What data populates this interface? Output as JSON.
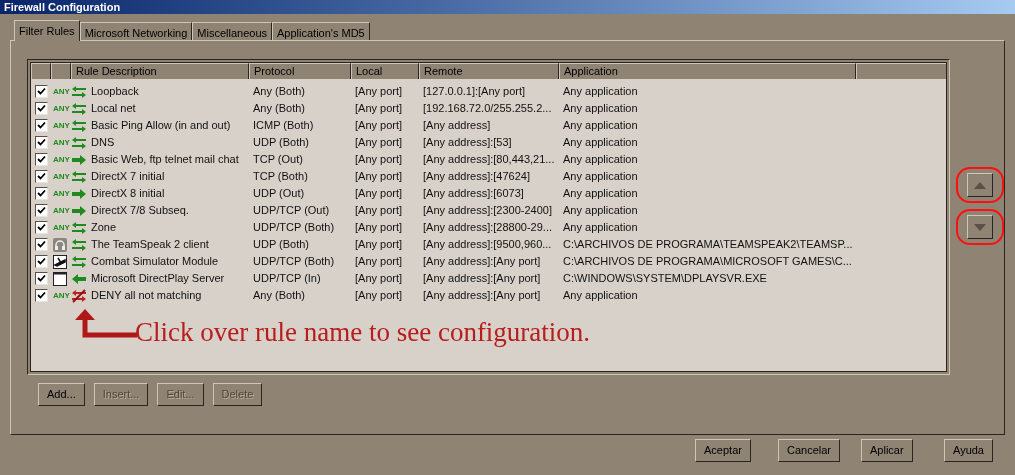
{
  "window": {
    "title": "Firewall Configuration"
  },
  "tabs": [
    {
      "label": "Filter Rules",
      "selected": true
    },
    {
      "label": "Microsoft Networking",
      "selected": false
    },
    {
      "label": "Miscellaneous",
      "selected": false
    },
    {
      "label": "Application's MD5",
      "selected": false
    }
  ],
  "table": {
    "columns": [
      "Rule Description",
      "Protocol",
      "Local",
      "Remote",
      "Application"
    ],
    "rows": [
      {
        "checked": true,
        "source": {
          "kind": "any",
          "label": "ANY"
        },
        "arrow": {
          "kind": "both"
        },
        "description": "Loopback",
        "protocol": "Any (Both)",
        "local": "[Any port]",
        "remote": "[127.0.0.1]:[Any port]",
        "application": "Any application"
      },
      {
        "checked": true,
        "source": {
          "kind": "any",
          "label": "ANY"
        },
        "arrow": {
          "kind": "both"
        },
        "description": "Local net",
        "protocol": "Any (Both)",
        "local": "[Any port]",
        "remote": "[192.168.72.0/255.255.2...",
        "application": "Any application"
      },
      {
        "checked": true,
        "source": {
          "kind": "any",
          "label": "ANY"
        },
        "arrow": {
          "kind": "both"
        },
        "description": "Basic Ping Allow (in and out)",
        "protocol": "ICMP (Both)",
        "local": "[Any port]",
        "remote": "[Any address]",
        "application": "Any application"
      },
      {
        "checked": true,
        "source": {
          "kind": "any",
          "label": "ANY"
        },
        "arrow": {
          "kind": "both"
        },
        "description": "DNS",
        "protocol": "UDP (Both)",
        "local": "[Any port]",
        "remote": "[Any address]:[53]",
        "application": "Any application"
      },
      {
        "checked": true,
        "source": {
          "kind": "any",
          "label": "ANY"
        },
        "arrow": {
          "kind": "out"
        },
        "description": "Basic Web, ftp telnet mail chat",
        "protocol": "TCP (Out)",
        "local": "[Any port]",
        "remote": "[Any address]:[80,443,21...",
        "application": "Any application"
      },
      {
        "checked": true,
        "source": {
          "kind": "any",
          "label": "ANY"
        },
        "arrow": {
          "kind": "both"
        },
        "description": "DirectX 7 initial",
        "protocol": "TCP (Both)",
        "local": "[Any port]",
        "remote": "[Any address]:[47624]",
        "application": "Any application"
      },
      {
        "checked": true,
        "source": {
          "kind": "any",
          "label": "ANY"
        },
        "arrow": {
          "kind": "out"
        },
        "description": "DirectX 8 initial",
        "protocol": "UDP (Out)",
        "local": "[Any port]",
        "remote": "[Any address]:[6073]",
        "application": "Any application"
      },
      {
        "checked": true,
        "source": {
          "kind": "any",
          "label": "ANY"
        },
        "arrow": {
          "kind": "out"
        },
        "description": "DirectX  7/8 Subseq.",
        "protocol": "UDP/TCP (Out)",
        "local": "[Any port]",
        "remote": "[Any address]:[2300-2400]",
        "application": "Any application"
      },
      {
        "checked": true,
        "source": {
          "kind": "any",
          "label": "ANY"
        },
        "arrow": {
          "kind": "both"
        },
        "description": "Zone",
        "protocol": "UDP/TCP (Both)",
        "local": "[Any port]",
        "remote": "[Any address]:[28800-29...",
        "application": "Any application"
      },
      {
        "checked": true,
        "source": {
          "kind": "headset"
        },
        "arrow": {
          "kind": "both"
        },
        "description": "The TeamSpeak 2 client",
        "protocol": "UDP (Both)",
        "local": "[Any port]",
        "remote": "[Any address]:[9500,960...",
        "application": "C:\\ARCHIVOS DE PROGRAMA\\TEAMSPEAK2\\TEAMSP..."
      },
      {
        "checked": true,
        "source": {
          "kind": "plane"
        },
        "arrow": {
          "kind": "both"
        },
        "description": "Combat Simulator Module",
        "protocol": "UDP/TCP (Both)",
        "local": "[Any port]",
        "remote": "[Any address]:[Any port]",
        "application": "C:\\ARCHIVOS DE PROGRAMA\\MICROSOFT GAMES\\C..."
      },
      {
        "checked": true,
        "source": {
          "kind": "window"
        },
        "arrow": {
          "kind": "in"
        },
        "description": "Microsoft DirectPlay Server",
        "protocol": "UDP/TCP (In)",
        "local": "[Any port]",
        "remote": "[Any address]:[Any port]",
        "application": "C:\\WINDOWS\\SYSTEM\\DPLAYSVR.EXE"
      },
      {
        "checked": true,
        "source": {
          "kind": "any",
          "label": "ANY"
        },
        "arrow": {
          "kind": "deny"
        },
        "description": "DENY all not matching",
        "protocol": "Any (Both)",
        "local": "[Any port]",
        "remote": "[Any address]:[Any port]",
        "application": "Any application"
      }
    ]
  },
  "annotation": "Click over rule name to see configuration.",
  "rule_buttons": [
    {
      "label": "Add...",
      "disabled": false
    },
    {
      "label": "Insert...",
      "disabled": true
    },
    {
      "label": "Edit...",
      "disabled": true
    },
    {
      "label": "Delete",
      "disabled": true
    }
  ],
  "dialog_buttons": [
    "Aceptar",
    "Cancelar",
    "Aplicar",
    "Ayuda"
  ]
}
